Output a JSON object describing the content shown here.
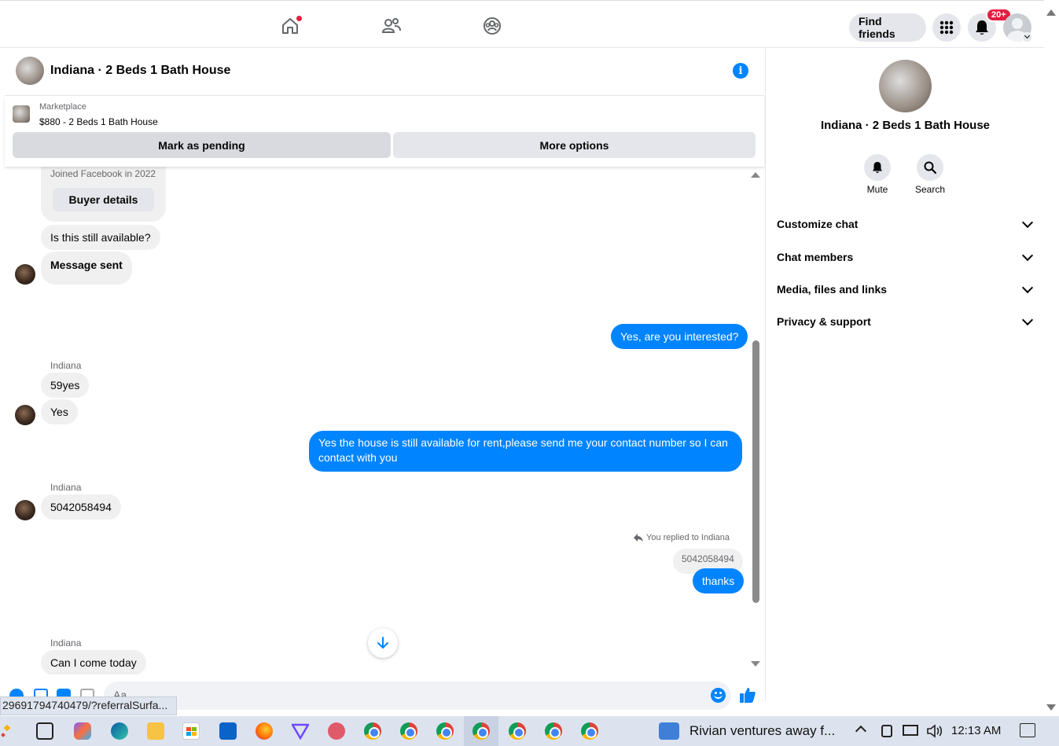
{
  "topbar": {
    "find_friends": "Find friends",
    "notifications_badge": "20+"
  },
  "chat": {
    "title": "Indiana · 2 Beds 1 Bath House",
    "listing": {
      "source": "Marketplace",
      "price_title": "$880 - 2 Beds 1 Bath House",
      "mark_pending": "Mark as pending",
      "more_options": "More options"
    },
    "messages": {
      "joined": "Joined Facebook in 2022",
      "buyer_details": "Buyer details",
      "m1": "Is this still available?",
      "m2": "Message sent",
      "m3": "Yes, are you interested?",
      "sender1": "Indiana",
      "m4": "59yes",
      "m5": "Yes",
      "m6": "Yes the house is still available for rent,please send me your contact number so I can contact with you",
      "sender2": "Indiana",
      "m7": "5042058494",
      "reply_label": "You replied to Indiana",
      "reply_quote": "5042058494",
      "m8": "thanks",
      "sender3": "Indiana",
      "m9": "Can I come today"
    },
    "composer_placeholder": "Aa"
  },
  "panel": {
    "name": "Indiana · 2 Beds 1 Bath House",
    "mute": "Mute",
    "search": "Search",
    "sections": [
      "Customize chat",
      "Chat members",
      "Media, files and links",
      "Privacy & support"
    ]
  },
  "status_url": "29691794740479/?referralSurfa...",
  "taskbar": {
    "news": "Rivian ventures away f...",
    "time": "12:13 AM"
  },
  "colors": {
    "accent": "#0084ff",
    "badge": "#e41e3f"
  }
}
